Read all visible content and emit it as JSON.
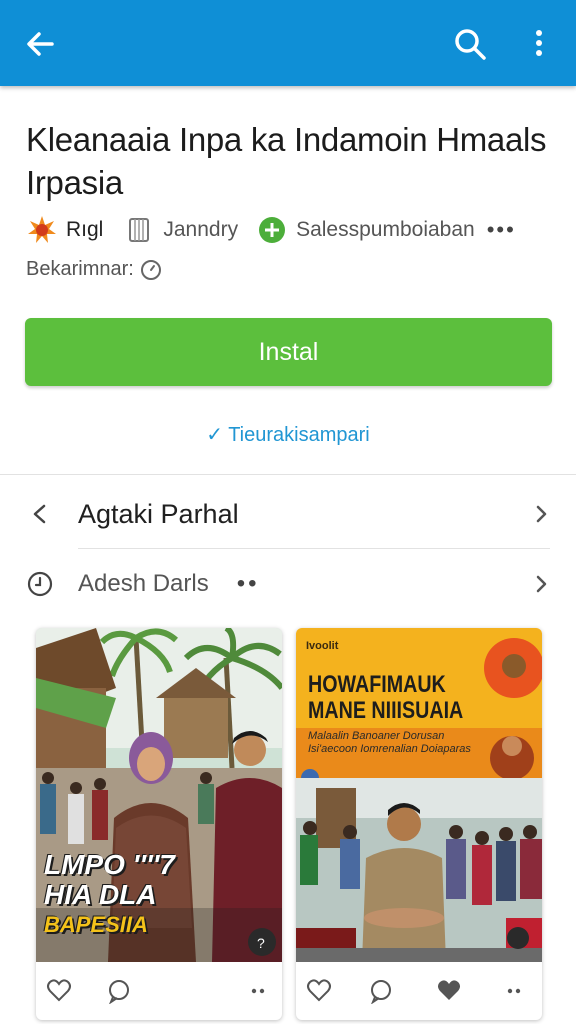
{
  "app_bar": {
    "color": "#0f8fd6",
    "icons": [
      "back-arrow-icon",
      "search-icon",
      "more-vert-icon"
    ]
  },
  "app": {
    "title": "Kleanaaia Inpa ka Indamoin Hmaals Irpasia",
    "developer": "Rıgl",
    "category": "Janndry",
    "feature": "Salesspumboiaban",
    "more": "•••",
    "subline": "Bekarimnar:"
  },
  "install": {
    "label": "Instal",
    "color": "#5cbf3d"
  },
  "verified_text": "✓ Tieurakisampari",
  "rows": [
    {
      "label": "Agtaki Parhal",
      "icon": "chevron-left-icon"
    },
    {
      "label": "Adesh Darls",
      "extra": "••",
      "icon": "clock-icon"
    }
  ],
  "cards": [
    {
      "overlay_line1": "LMPO ''''7",
      "overlay_line2": "HIA DLA",
      "overlay_line3": "BAPESIIA",
      "actions": [
        "heart-icon",
        "comment-icon",
        "more-horiz-icon"
      ]
    },
    {
      "poster_small": "Ivoolit",
      "poster_head": "HOWAFIMAUK MANE NIIISUAIA",
      "poster_sub": "Malaalin Banoaner Dorusan Isi'aecoon Iomrenalian Doiaparas",
      "actions": [
        "heart-icon",
        "comment-icon",
        "heart-filled-icon",
        "more-horiz-icon"
      ]
    }
  ]
}
